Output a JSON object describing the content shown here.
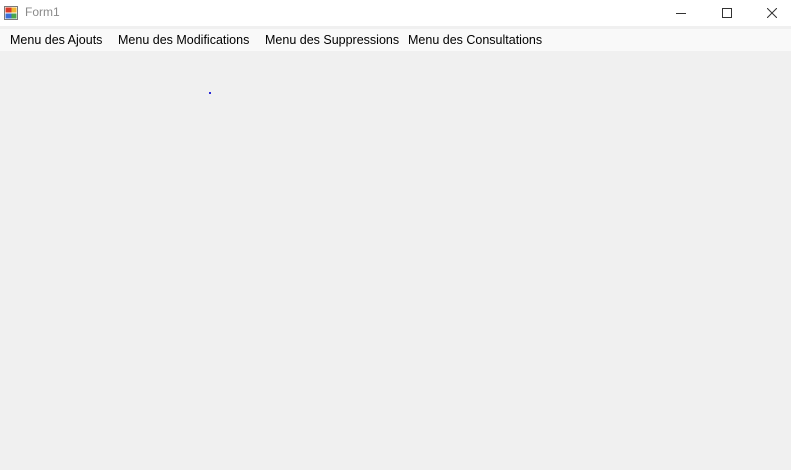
{
  "window": {
    "title": "Form1",
    "icon": "winforms-app-icon"
  },
  "title_bar": {
    "minimize_icon": "minimize-icon",
    "maximize_icon": "maximize-icon",
    "close_icon": "close-icon"
  },
  "menu_bar": {
    "items": [
      {
        "label": "Menu des Ajouts"
      },
      {
        "label": "Menu des Modifications"
      },
      {
        "label": "Menu des Suppressions"
      },
      {
        "label": "Menu des Consultations"
      }
    ]
  },
  "colors": {
    "form_background": "#f0f0f0",
    "menu_background": "#f9f9f9",
    "title_background": "#ffffff",
    "title_text": "#8a8a8a",
    "marker": "#2a2ad6"
  }
}
